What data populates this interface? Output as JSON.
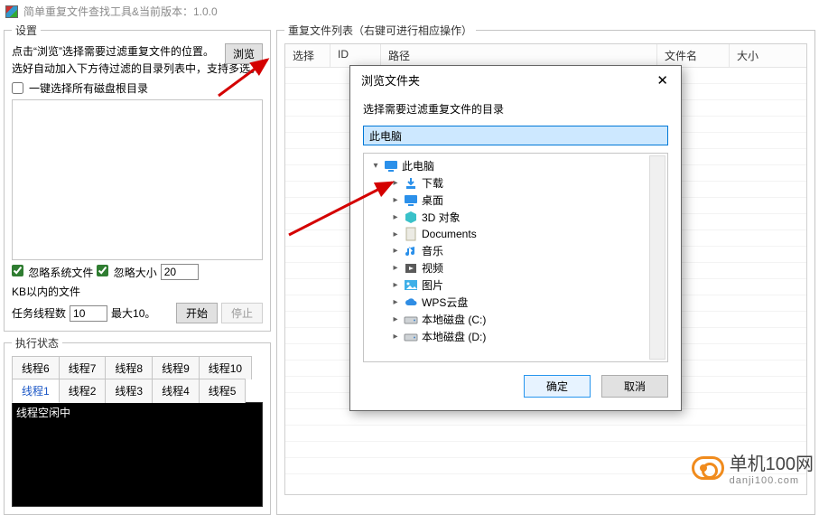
{
  "app": {
    "title": "简单重复文件查找工具&当前版本：1.0.0"
  },
  "settings": {
    "legend": "设置",
    "desc_line1": "点击“浏览”选择需要过滤重复文件的位置。",
    "desc_line2": "选好自动加入下方待过滤的目录列表中，支持多选。",
    "browse_label": "浏览",
    "select_all_roots_label": "一键选择所有磁盘根目录",
    "ignore_sys_label": "忽略系统文件",
    "ignore_size_label": "忽略大小",
    "ignore_size_value": "20",
    "ignore_size_suffix": "KB以内的文件",
    "threads_label": "任务线程数",
    "threads_value": "10",
    "threads_max_label": "最大10。",
    "start_label": "开始",
    "stop_label": "停止"
  },
  "status": {
    "legend": "执行状态",
    "tabs_row1": [
      "线程6",
      "线程7",
      "线程8",
      "线程9",
      "线程10"
    ],
    "tabs_row2": [
      "线程1",
      "线程2",
      "线程3",
      "线程4",
      "线程5"
    ],
    "active_tab": "线程1",
    "console_text": "线程空闲中"
  },
  "dup_list": {
    "legend": "重复文件列表（右键可进行相应操作）",
    "columns": {
      "select": "选择",
      "id": "ID",
      "path": "路径",
      "name": "文件名",
      "size": "大小"
    }
  },
  "dialog": {
    "title": "浏览文件夹",
    "prompt": "选择需要过滤重复文件的目录",
    "path_value": "此电脑",
    "root_label": "此电脑",
    "children": [
      {
        "icon": "download",
        "label": "下载"
      },
      {
        "icon": "desktop",
        "label": "桌面"
      },
      {
        "icon": "cube",
        "label": "3D 对象"
      },
      {
        "icon": "doc",
        "label": "Documents"
      },
      {
        "icon": "music",
        "label": "音乐"
      },
      {
        "icon": "video",
        "label": "视频"
      },
      {
        "icon": "image",
        "label": "图片"
      },
      {
        "icon": "cloud",
        "label": "WPS云盘"
      },
      {
        "icon": "drive",
        "label": "本地磁盘 (C:)"
      },
      {
        "icon": "drive",
        "label": "本地磁盘 (D:)"
      }
    ],
    "ok_label": "确定",
    "cancel_label": "取消"
  },
  "watermark": {
    "brand": "单机100网",
    "domain": "danji100.com"
  }
}
